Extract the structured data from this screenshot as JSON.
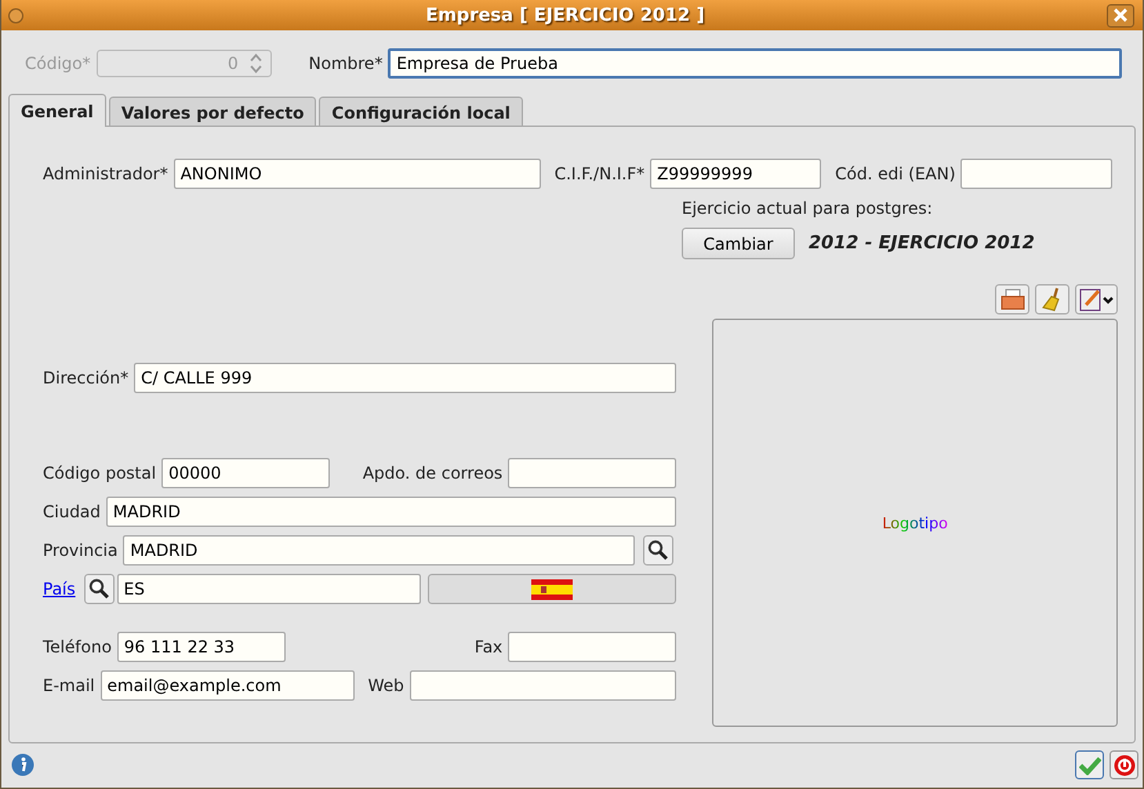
{
  "window": {
    "title": "Empresa [ EJERCICIO 2012 ]"
  },
  "header": {
    "code": {
      "label": "Código*",
      "value": "0",
      "disabled": true
    },
    "name": {
      "label": "Nombre*",
      "value": "Empresa de Prueba"
    }
  },
  "tabs": [
    {
      "label": "General",
      "selected": true
    },
    {
      "label": "Valores por defecto",
      "selected": false
    },
    {
      "label": "Configuración local",
      "selected": false
    }
  ],
  "general": {
    "administrator": {
      "label": "Administrador*",
      "value": "ANONIMO"
    },
    "cif": {
      "label": "C.I.F./N.I.F*",
      "value": "Z99999999"
    },
    "ean": {
      "label": "Cód. edi (EAN)"
    },
    "exercise": {
      "label": "Ejercicio actual para postgres:",
      "button": "Cambiar",
      "value": "2012 - EJERCICIO 2012"
    },
    "address": {
      "label": "Dirección*",
      "value": "C/ CALLE 999"
    },
    "postal_code": {
      "label": "Código postal",
      "value": "00000"
    },
    "po_box": {
      "label": "Apdo. de correos"
    },
    "city": {
      "label": "Ciudad",
      "value": "MADRID"
    },
    "province": {
      "label": "Provincia",
      "value": "MADRID"
    },
    "country": {
      "label": "País",
      "value": "ES"
    },
    "phone": {
      "label": "Teléfono",
      "value": "96 111 22 33"
    },
    "fax": {
      "label": "Fax"
    },
    "email": {
      "label": "E-mail",
      "value": "email@example.com"
    },
    "web": {
      "label": "Web"
    },
    "logo": {
      "placeholder": "Logotipo"
    }
  }
}
